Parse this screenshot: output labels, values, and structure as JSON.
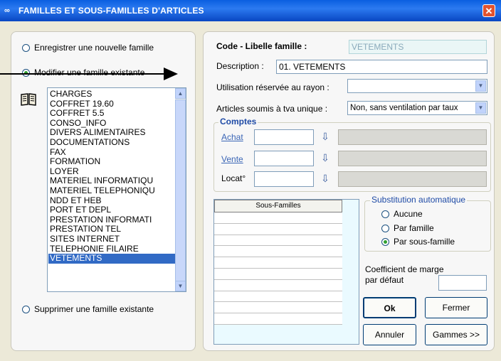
{
  "window": {
    "title": "FAMILLES ET SOUS-FAMILLES D'ARTICLES",
    "close": "✕"
  },
  "left": {
    "radio_new": "Enregistrer une nouvelle famille",
    "radio_modify": "Modifier une famille existante",
    "radio_delete": "Supprimer une famille existante",
    "families": [
      "CHARGES",
      "COFFRET 19.60",
      "COFFRET 5.5",
      "CONSO_INFO",
      "DIVERS ALIMENTAIRES",
      "DOCUMENTATIONS",
      "FAX",
      "FORMATION",
      "LOYER",
      "MATERIEL INFORMATIQU",
      "MATERIEL TELEPHONIQU",
      "NDD ET HEB",
      "PORT ET DEPL",
      "PRESTATION INFORMATI",
      "PRESTATION TEL",
      "SITES INTERNET",
      "TELEPHONIE FILAIRE",
      "VETEMENTS"
    ],
    "selected_index": 17
  },
  "right": {
    "code_label": "Code - Libelle famille :",
    "code_value": "VETEMENTS",
    "desc_label": "Description :",
    "desc_value": "01. VETEMENTS",
    "rayon_label": "Utilisation réservée au rayon :",
    "rayon_value": "",
    "tva_label": "Articles soumis à tva unique :",
    "tva_value": "Non, sans ventilation par taux",
    "comptes_title": "Comptes",
    "achat_label": "Achat",
    "vente_label": "Vente",
    "locat_label": "Locat°",
    "sous_familles_header": "Sous-Familles",
    "subst_title": "Substitution automatique",
    "subst_aucune": "Aucune",
    "subst_famille": "Par famille",
    "subst_sousfamille": "Par sous-famille",
    "coef_label_1": "Coefficient de marge",
    "coef_label_2": "par défaut",
    "coef_value": "",
    "btn_ok": "Ok",
    "btn_fermer": "Fermer",
    "btn_annuler": "Annuler",
    "btn_gammes": "Gammes >>"
  }
}
